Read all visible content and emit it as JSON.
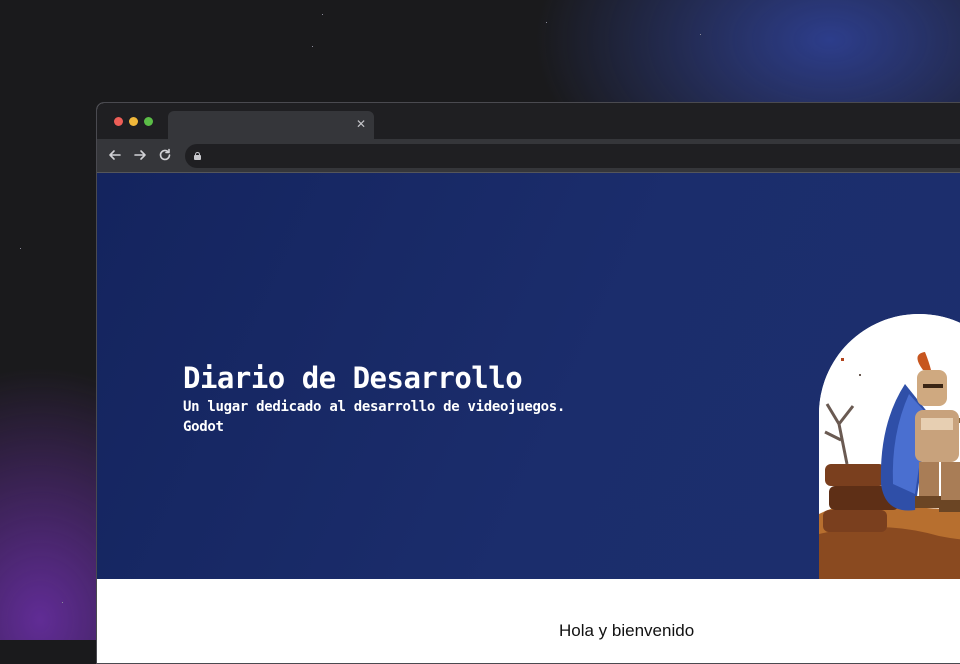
{
  "browser": {
    "tab": {
      "title": "",
      "close_icon": "close-icon"
    },
    "toolbar": {
      "back_icon": "arrow-left-icon",
      "forward_icon": "arrow-right-icon",
      "reload_icon": "reload-icon",
      "url": ""
    },
    "window_controls": {
      "close_color": "#ed5e57",
      "minimize_color": "#f0b73a",
      "maximize_color": "#5bbd47"
    }
  },
  "hero": {
    "title": "Diario de Desarrollo",
    "subtitle": "Un lugar dedicado al desarrollo de videojuegos.",
    "tag": "Godot",
    "image_subject": "pixel-art knight",
    "background_color": "#1a2b6a"
  },
  "content": {
    "welcome": "Hola y bienvenido"
  }
}
